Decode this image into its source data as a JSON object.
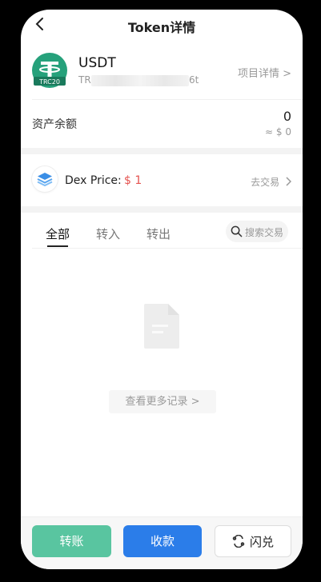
{
  "header": {
    "title": "Token详情"
  },
  "token": {
    "name": "USDT",
    "badge": "TRC20",
    "address_prefix": "TR",
    "address_suffix": "6t",
    "project_link": "项目详情 >"
  },
  "balance": {
    "label": "资产余额",
    "amount": "0",
    "usd": "≈ $ 0"
  },
  "dex": {
    "label": "Dex Price:",
    "price": "$ 1",
    "trade_link": "去交易"
  },
  "tabs": [
    {
      "label": "全部",
      "active": true
    },
    {
      "label": "转入",
      "active": false
    },
    {
      "label": "转出",
      "active": false
    }
  ],
  "search": {
    "placeholder": "搜索交易"
  },
  "empty": {
    "more_records": "查看更多记录 >"
  },
  "actions": {
    "transfer": "转账",
    "receive": "收款",
    "swap": "闪兑"
  },
  "colors": {
    "tether_green": "#26a17b",
    "transfer_green": "#59c5a0",
    "receive_blue": "#2b7de9",
    "price_red": "#e55350"
  }
}
